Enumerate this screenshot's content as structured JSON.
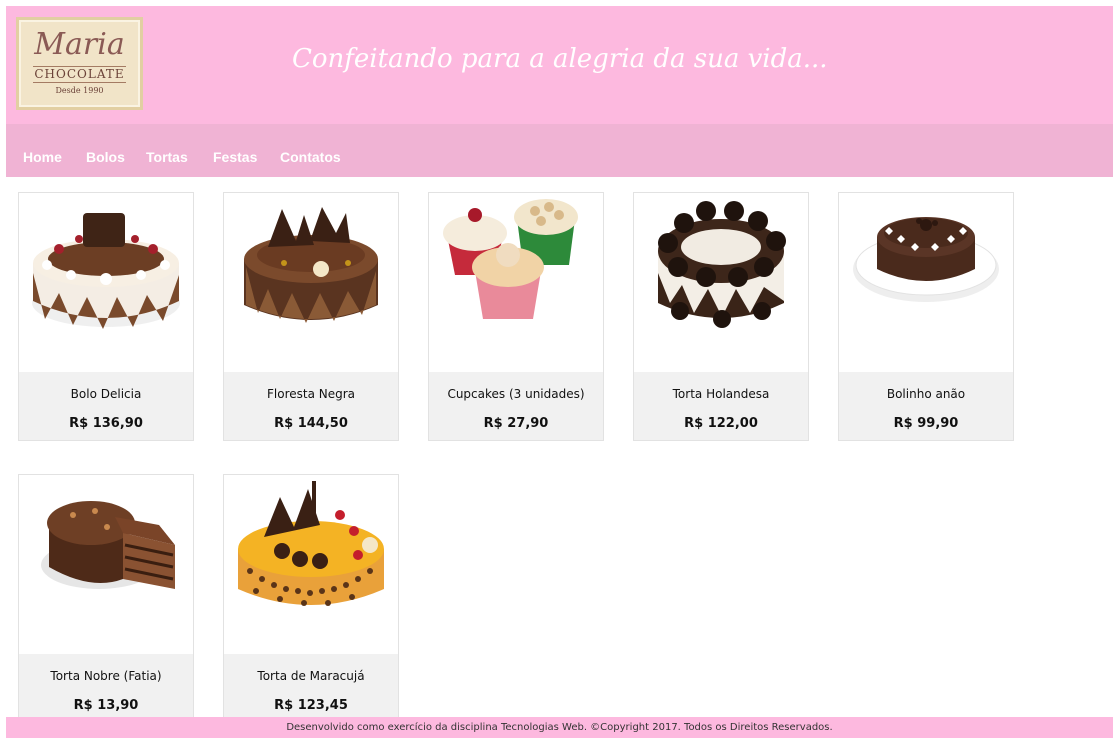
{
  "header": {
    "logo": {
      "script": "Maria",
      "caps": "CHOCOLATE",
      "since": "Desde 1990"
    },
    "tagline": "Confeitando para a alegria da sua vida..."
  },
  "nav": {
    "items": [
      {
        "label": "Home"
      },
      {
        "label": "Bolos"
      },
      {
        "label": "Tortas"
      },
      {
        "label": "Festas"
      },
      {
        "label": "Contatos"
      }
    ]
  },
  "products": [
    {
      "name": "Bolo Delicia",
      "price": "R$ 136,90",
      "image": "cake-chocolate-cream"
    },
    {
      "name": "Floresta Negra",
      "price": "R$ 144,50",
      "image": "cake-black-forest"
    },
    {
      "name": "Cupcakes (3 unidades)",
      "price": "R$ 27,90",
      "image": "cupcakes"
    },
    {
      "name": "Torta Holandesa",
      "price": "R$ 122,00",
      "image": "cake-cookies"
    },
    {
      "name": "Bolinho anão",
      "price": "R$ 99,90",
      "image": "cake-hearts"
    },
    {
      "name": "Torta Nobre (Fatia)",
      "price": "R$ 13,90",
      "image": "cake-slice"
    },
    {
      "name": "Torta de Maracujá",
      "price": "R$ 123,45",
      "image": "cake-passion-fruit"
    }
  ],
  "footer": {
    "text": "Desenvolvido como exercício da disciplina Tecnologias Web. ©Copyright 2017. Todos os Direitos Reservados."
  },
  "colors": {
    "header_bg": "#fdb9df",
    "nav_bg": "#f0b3d4",
    "card_info_bg": "#f1f1f1"
  }
}
